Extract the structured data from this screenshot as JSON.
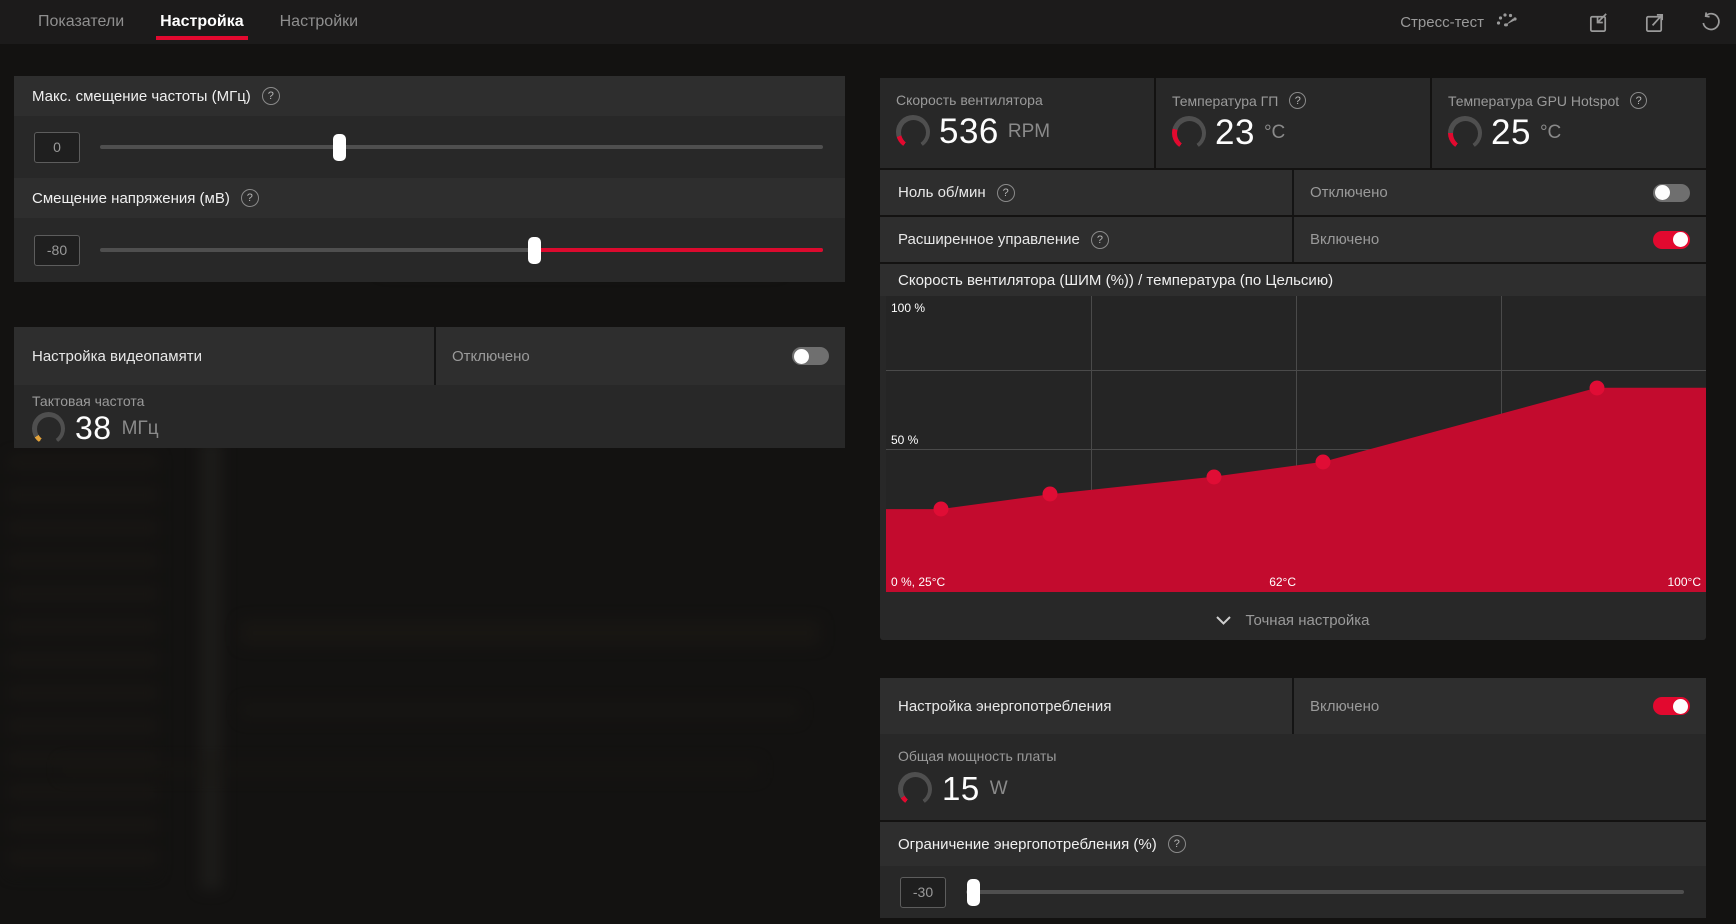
{
  "colors": {
    "accent": "#e2092f",
    "chart_fill": "#c30b2e",
    "chart_dot": "#e00d35",
    "slider_red": "#dc0a2e",
    "gauge_gray": "#4f4f4f",
    "gauge_orange": "#e2a23b"
  },
  "topbar": {
    "tabs": [
      {
        "label": "Показатели",
        "active": false
      },
      {
        "label": "Настройка",
        "active": true
      },
      {
        "label": "Настройки",
        "active": false
      }
    ],
    "stress_test_label": "Стресс-тест",
    "icons": [
      "gauge-icon",
      "import-profile-icon",
      "export-profile-icon",
      "reset-icon"
    ]
  },
  "left": {
    "freq_offset": {
      "title": "Макс. смещение частоты (МГц)",
      "value": "0",
      "slider": {
        "pos": 33,
        "fill": "none"
      }
    },
    "voltage_offset": {
      "title": "Смещение напряжения (мВ)",
      "value": "-80",
      "slider": {
        "pos": 60,
        "fill": "right"
      }
    },
    "vram": {
      "title": "Настройка видеопамяти",
      "status": "Отключено",
      "enabled": false,
      "clock": {
        "label": "Тактовая частота",
        "value": "38",
        "unit": "МГц",
        "gauge": {
          "color": "#e2a23b",
          "sweep": 22
        }
      }
    }
  },
  "right": {
    "stats": [
      {
        "label": "Скорость вентилятора",
        "value": "536",
        "unit": "RPM",
        "help": false,
        "gauge": {
          "color": "#e2092f",
          "sweep": 38
        }
      },
      {
        "label": "Температура ГП",
        "value": "23",
        "unit": "°C",
        "help": true,
        "gauge": {
          "color": "#e2092f",
          "sweep": 70
        }
      },
      {
        "label": "Температура GPU Hotspot",
        "value": "25",
        "unit": "°C",
        "help": true,
        "gauge": {
          "color": "#e2092f",
          "sweep": 55
        }
      }
    ],
    "zero_rpm": {
      "label": "Ноль об/мин",
      "status": "Отключено",
      "enabled": false
    },
    "advanced": {
      "label": "Расширенное управление",
      "status": "Включено",
      "enabled": true
    },
    "fan_chart_title": "Скорость вентилятора (ШИМ (%)) / температура (по Цельсию)",
    "fine_tune_label": "Точная настройка",
    "power": {
      "title": "Настройка энергопотребления",
      "status": "Включено",
      "enabled": true,
      "board_power": {
        "label": "Общая мощность платы",
        "value": "15",
        "unit": "W",
        "gauge": {
          "color": "#e2092f",
          "sweep": 22
        }
      },
      "power_limit": {
        "title": "Ограничение энергопотребления (%)",
        "value": "-30",
        "slider": {
          "pos": 1,
          "fill": "none"
        }
      }
    }
  },
  "chart_data": {
    "type": "area",
    "title": "Скорость вентилятора (ШИМ (%)) / температура (по Цельсию)",
    "xlabel": "температура (по Цельсию)",
    "ylabel": "Скорость вентилятора (ШИМ (%))",
    "xlim": [
      25,
      100
    ],
    "ylim": [
      0,
      100
    ],
    "points": [
      [
        30,
        28
      ],
      [
        40,
        33
      ],
      [
        55,
        39
      ],
      [
        65,
        44
      ],
      [
        90,
        69
      ]
    ],
    "y_tick_labels": [
      "100 %",
      "50 %"
    ],
    "x_tick_labels": [
      "0 %, 25°C",
      "62°C",
      "100°C"
    ],
    "grid": true,
    "legend": false
  }
}
